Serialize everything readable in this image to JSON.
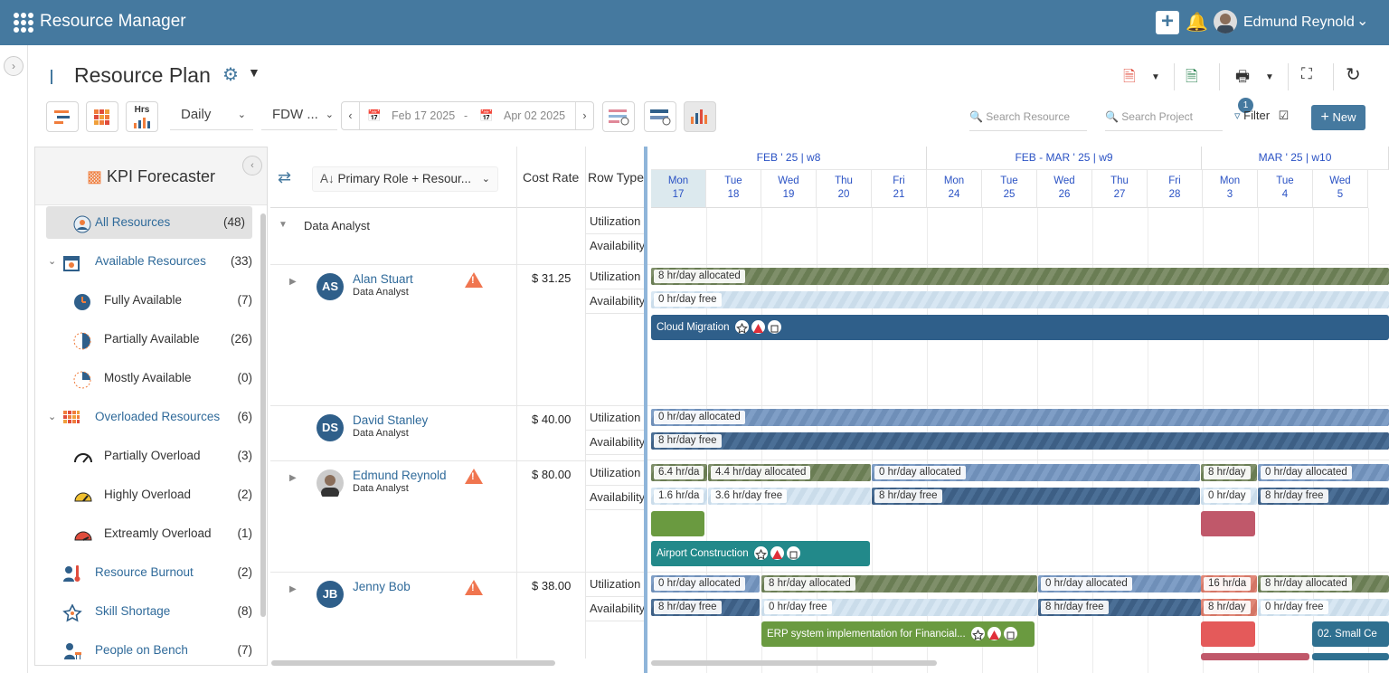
{
  "app": {
    "title": "Resource Manager",
    "user": "Edmund Reynold"
  },
  "page": {
    "title": "Resource Plan"
  },
  "toolbar": {
    "view": "Daily",
    "fdw": "FDW ...",
    "start_date": "Feb 17 2025",
    "end_date": "Apr 02 2025",
    "date_sep": "-",
    "search_resource": "Search Resource",
    "search_project": "Search Project",
    "filter_label": "Filter",
    "filter_count": "1",
    "new_label": "New",
    "hrs_label": "Hrs"
  },
  "kpi": {
    "title": "KPI Forecaster",
    "items": [
      {
        "label": "All Resources",
        "count": "(48)"
      },
      {
        "label": "Available Resources",
        "count": "(33)"
      },
      {
        "label": "Fully Available",
        "count": "(7)"
      },
      {
        "label": "Partially Available",
        "count": "(26)"
      },
      {
        "label": "Mostly Available",
        "count": "(0)"
      },
      {
        "label": "Overloaded Resources",
        "count": "(6)"
      },
      {
        "label": "Partially Overload",
        "count": "(3)"
      },
      {
        "label": "Highly Overload",
        "count": "(2)"
      },
      {
        "label": "Extreamly Overload",
        "count": "(1)"
      },
      {
        "label": "Resource Burnout",
        "count": "(2)"
      },
      {
        "label": "Skill Shortage",
        "count": "(8)"
      },
      {
        "label": "People on Bench",
        "count": "(7)"
      }
    ]
  },
  "grid": {
    "sort_label": "Primary Role + Resour...",
    "col_cost": "Cost Rate",
    "col_rowtype": "Row Type",
    "group": "Data Analyst",
    "utilization": "Utilization",
    "availability": "Availability",
    "resources": [
      {
        "initials": "AS",
        "name": "Alan Stuart",
        "role": "Data Analyst",
        "rate": "$ 31.25"
      },
      {
        "initials": "DS",
        "name": "David Stanley",
        "role": "Data Analyst",
        "rate": "$ 40.00"
      },
      {
        "initials": "",
        "name": "Edmund Reynold",
        "role": "Data Analyst",
        "rate": "$ 80.00"
      },
      {
        "initials": "JB",
        "name": "Jenny Bob",
        "role": "",
        "rate": "$ 38.00"
      }
    ]
  },
  "timeline": {
    "weeks": [
      "FEB ' 25 | w8",
      "FEB - MAR ' 25 | w9",
      "MAR ' 25 | w10"
    ],
    "days": [
      {
        "d": "Mon",
        "n": "17"
      },
      {
        "d": "Tue",
        "n": "18"
      },
      {
        "d": "Wed",
        "n": "19"
      },
      {
        "d": "Thu",
        "n": "20"
      },
      {
        "d": "Fri",
        "n": "21"
      },
      {
        "d": "Mon",
        "n": "24"
      },
      {
        "d": "Tue",
        "n": "25"
      },
      {
        "d": "Wed",
        "n": "26"
      },
      {
        "d": "Thu",
        "n": "27"
      },
      {
        "d": "Fri",
        "n": "28"
      },
      {
        "d": "Mon",
        "n": "3"
      },
      {
        "d": "Tue",
        "n": "4"
      },
      {
        "d": "Wed",
        "n": "5"
      }
    ],
    "bars": {
      "as_alloc": "8 hr/day allocated",
      "as_free": "0 hr/day free",
      "ds_alloc": "0 hr/day allocated",
      "ds_free": "8 hr/day free",
      "er_a1": "6.4 hr/da",
      "er_a2": "4.4 hr/day allocated",
      "er_a3": "0 hr/day allocated",
      "er_a4": "8 hr/day",
      "er_a5": "0 hr/day allocated",
      "er_f1": "1.6 hr/da",
      "er_f2": "3.6 hr/day free",
      "er_f3": "8 hr/day free",
      "er_f4": "0 hr/day",
      "er_f5": "8 hr/day free",
      "jb_a1": "0 hr/day allocated",
      "jb_a2": "8 hr/day allocated",
      "jb_a3": "0 hr/day allocated",
      "jb_a4": "16 hr/da",
      "jb_a5": "8 hr/day allocated",
      "jb_f1": "8 hr/day free",
      "jb_f2": "0 hr/day free",
      "jb_f3": "8 hr/day free",
      "jb_f4": "8 hr/day",
      "jb_f5": "0 hr/day free"
    },
    "tasks": {
      "cloud": "Cloud Migration",
      "airport": "Airport Construction",
      "erp": "ERP system implementation for Financial...",
      "small": "02. Small Ce"
    }
  },
  "colors": {
    "brand": "#45799f",
    "warning": "#f0754f"
  }
}
